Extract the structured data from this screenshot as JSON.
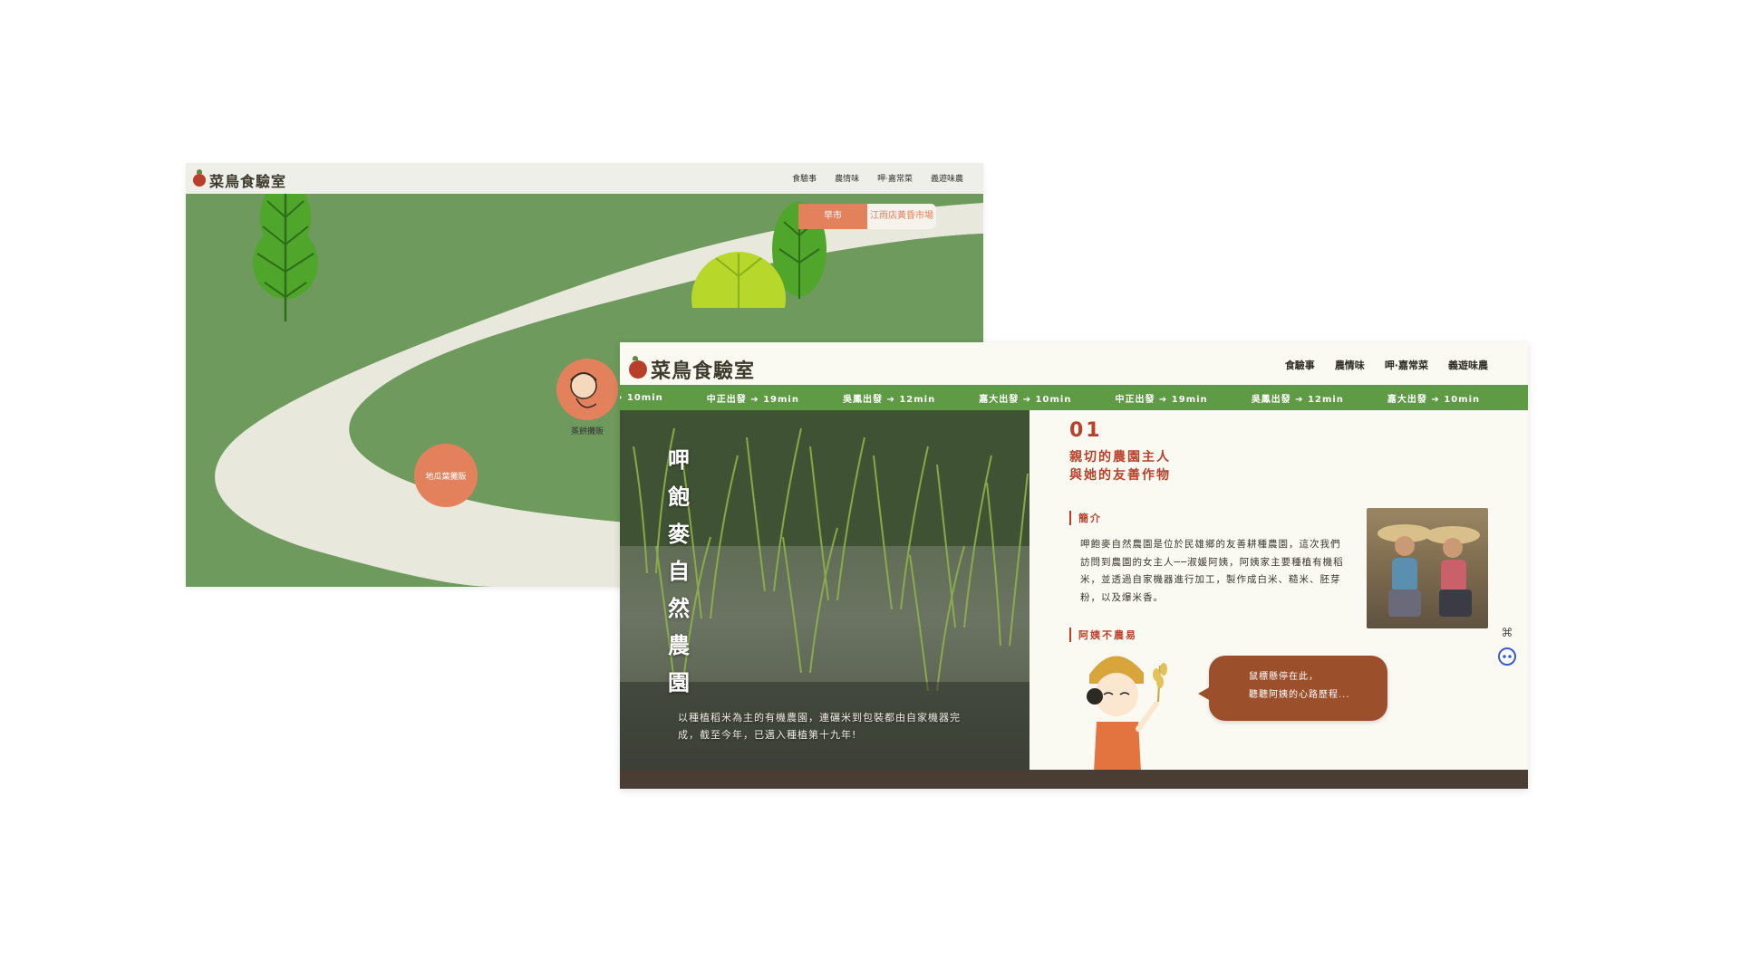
{
  "back_window": {
    "logo": "菜鳥食驗室",
    "nav": [
      "食驗事",
      "農情味",
      "呷·嘉常菜",
      "義遊味農"
    ],
    "market_tabs": [
      "早市",
      "江雨店黃昏市場"
    ],
    "stall_label": "地瓜葉攤販",
    "farmer_label": "蒸餅攤販"
  },
  "front_window": {
    "logo": "菜鳥食驗室",
    "nav": [
      "食驗事",
      "農情味",
      "呷·嘉常菜",
      "義遊味農"
    ],
    "ticker": [
      "➔ 10min",
      "中正出發 ➔ 19min",
      "吳鳳出發 ➔ 12min",
      "嘉大出發 ➔ 10min",
      "中正出發 ➔ 19min",
      "吳鳳出發 ➔ 12min",
      "嘉大出發 ➔ 10min"
    ],
    "farm_title": "呷飽麥自然農園",
    "photo_caption": "以種植稻米為主的有機農園，連碾米到包裝都由自家機器完成，截至今年，已邁入種植第十九年!",
    "section_number": "01",
    "heading_line1": "親切的農園主人",
    "heading_line2": "與她的友善作物",
    "intro_label": "簡介",
    "intro_text": "呷飽麥自然農園是位於民雄鄉的友善耕種農園，這次我們訪問到農園的女主人──淑媛阿姨，阿姨家主要種植有機稻米，並透過自家機器進行加工，製作成白米、糙米、胚芽粉，以及爆米香。",
    "second_label": "阿姨不農易",
    "bubble_line1": "鼠標懸停在此，",
    "bubble_line2": "聽聽阿姨的心路歷程..."
  },
  "colors": {
    "field_green": "#6e9a5d",
    "ticker_green": "#5f9a45",
    "accent_orange": "#e3815d",
    "title_red": "#b9412b",
    "bubble_brown": "#9b4f2b"
  }
}
